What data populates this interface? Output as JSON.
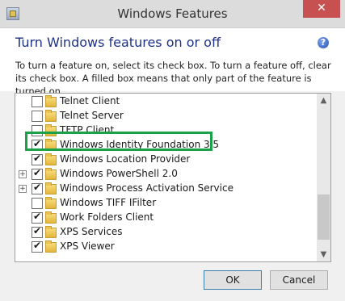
{
  "window": {
    "title": "Windows Features",
    "close_glyph": "✕"
  },
  "header": {
    "heading": "Turn Windows features on or off",
    "help_glyph": "?",
    "description": "To turn a feature on, select its check box. To turn a feature off, clear its check box. A filled box means that only part of the feature is turned on."
  },
  "features": [
    {
      "label": "Telnet Client",
      "checked": false,
      "expandable": false
    },
    {
      "label": "Telnet Server",
      "checked": false,
      "expandable": false
    },
    {
      "label": "TFTP Client",
      "checked": false,
      "expandable": false
    },
    {
      "label": "Windows Identity Foundation 3.5",
      "checked": true,
      "expandable": false,
      "highlighted": true
    },
    {
      "label": "Windows Location Provider",
      "checked": true,
      "expandable": false
    },
    {
      "label": "Windows PowerShell 2.0",
      "checked": true,
      "expandable": true
    },
    {
      "label": "Windows Process Activation Service",
      "checked": true,
      "expandable": true
    },
    {
      "label": "Windows TIFF IFilter",
      "checked": false,
      "expandable": false
    },
    {
      "label": "Work Folders Client",
      "checked": true,
      "expandable": false
    },
    {
      "label": "XPS Services",
      "checked": true,
      "expandable": false
    },
    {
      "label": "XPS Viewer",
      "checked": true,
      "expandable": false
    }
  ],
  "scrollbar": {
    "up_glyph": "▲",
    "down_glyph": "▼"
  },
  "buttons": {
    "ok": "OK",
    "cancel": "Cancel"
  },
  "colors": {
    "highlight": "#1aa14a",
    "heading": "#1e3287",
    "close": "#c75050"
  }
}
